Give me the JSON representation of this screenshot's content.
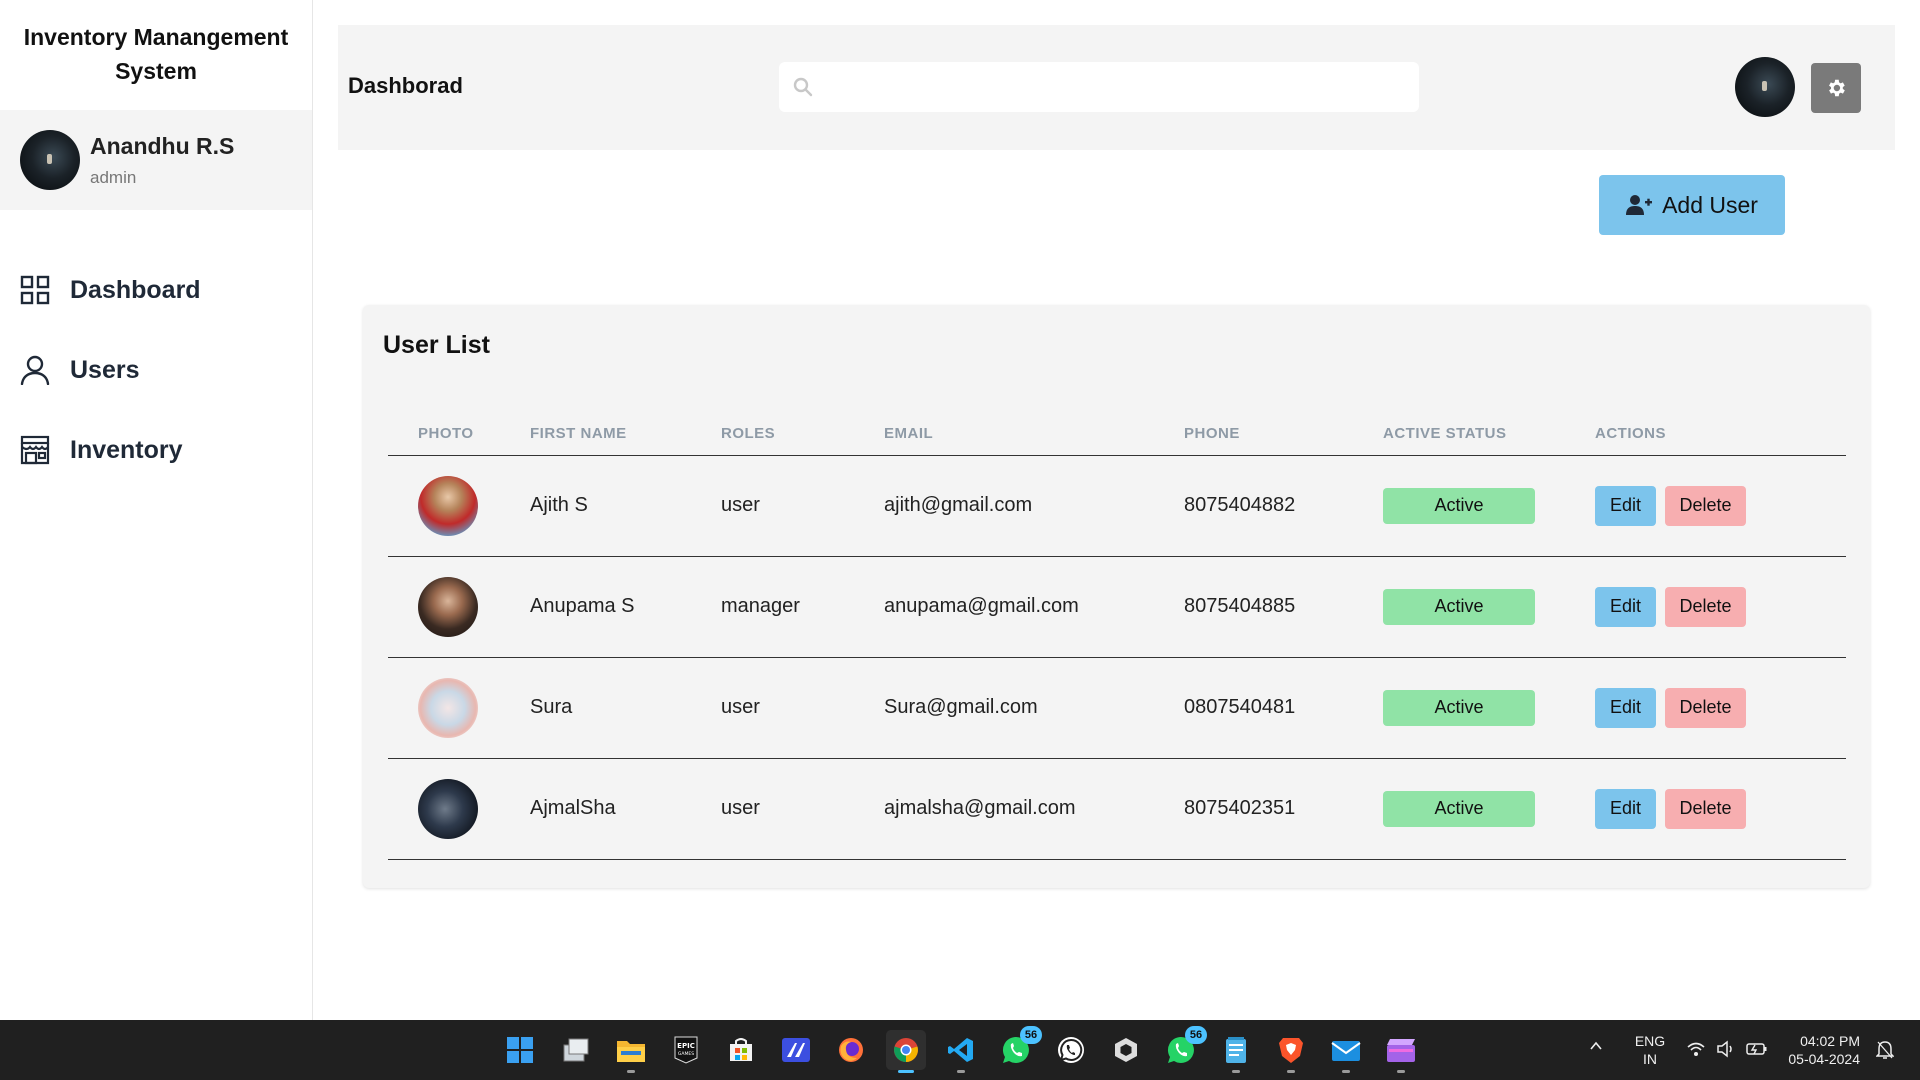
{
  "sidebar": {
    "app_title": "Inventory Manangement System",
    "profile": {
      "name": "Anandhu R.S",
      "role": "admin"
    },
    "nav": [
      {
        "label": "Dashboard",
        "icon": "grid-icon"
      },
      {
        "label": "Users",
        "icon": "user-icon"
      },
      {
        "label": "Inventory",
        "icon": "store-icon"
      }
    ]
  },
  "header": {
    "title": "Dashborad",
    "search": {
      "placeholder": "",
      "value": ""
    }
  },
  "main": {
    "add_user_label": "Add User",
    "user_list": {
      "title": "User List",
      "columns": [
        "PHOTO",
        "FIRST NAME",
        "ROLES",
        "EMAIL",
        "PHONE",
        "ACTIVE STATUS",
        "ACTIONS"
      ],
      "rows": [
        {
          "first_name": "Ajith S",
          "role": "user",
          "email": "ajith@gmail.com",
          "phone": "8075404882",
          "status": "Active",
          "edit": "Edit",
          "delete": "Delete"
        },
        {
          "first_name": "Anupama S",
          "role": "manager",
          "email": "anupama@gmail.com",
          "phone": "8075404885",
          "status": "Active",
          "edit": "Edit",
          "delete": "Delete"
        },
        {
          "first_name": "Sura",
          "role": "user",
          "email": "Sura@gmail.com",
          "phone": "0807540481",
          "status": "Active",
          "edit": "Edit",
          "delete": "Delete"
        },
        {
          "first_name": "AjmalSha",
          "role": "user",
          "email": "ajmalsha@gmail.com",
          "phone": "8075402351",
          "status": "Active",
          "edit": "Edit",
          "delete": "Delete"
        }
      ]
    }
  },
  "colors": {
    "primary_button": "#7cc4ec",
    "delete_button": "#f7aeb0",
    "status_active": "#90e3a6",
    "panel_bg": "#f4f4f4",
    "settings_button": "#7a7a7a",
    "taskbar_bg": "#202020"
  },
  "taskbar": {
    "apps": [
      {
        "name": "windows-start-icon"
      },
      {
        "name": "task-view-icon"
      },
      {
        "name": "file-explorer-icon"
      },
      {
        "name": "epic-games-icon",
        "label": "EPIC GAMES"
      },
      {
        "name": "microsoft-store-icon"
      },
      {
        "name": "app-icon"
      },
      {
        "name": "firefox-icon"
      },
      {
        "name": "chrome-icon",
        "active": true
      },
      {
        "name": "vscode-icon"
      },
      {
        "name": "whatsapp-business-icon",
        "badge": "56"
      },
      {
        "name": "whatsapp-icon"
      },
      {
        "name": "unity-icon"
      },
      {
        "name": "whatsapp-icon",
        "badge": "56"
      },
      {
        "name": "notepad-icon"
      },
      {
        "name": "brave-icon"
      },
      {
        "name": "mail-icon"
      },
      {
        "name": "video-editor-icon"
      }
    ],
    "language": {
      "line1": "ENG",
      "line2": "IN"
    },
    "clock": {
      "time": "04:02 PM",
      "date": "05-04-2024"
    }
  }
}
